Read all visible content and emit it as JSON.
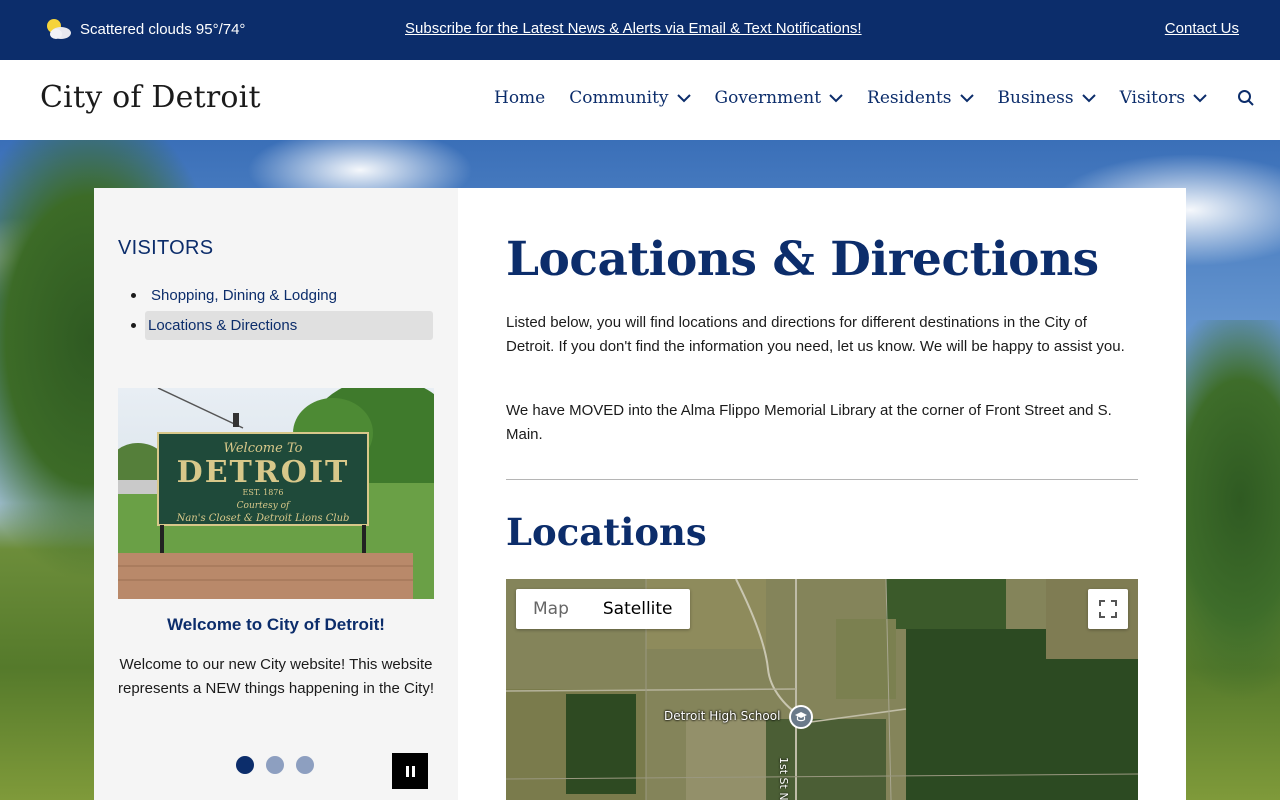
{
  "topbar": {
    "weather": "Scattered clouds 95°/74°",
    "subscribe_link": "Subscribe for the Latest News & Alerts via Email & Text Notifications!",
    "contact_link": "Contact Us"
  },
  "header": {
    "site_title": "City of Detroit",
    "nav": [
      {
        "label": "Home"
      },
      {
        "label": "Community"
      },
      {
        "label": "Government"
      },
      {
        "label": "Residents"
      },
      {
        "label": "Business"
      },
      {
        "label": "Visitors"
      }
    ]
  },
  "sidebar": {
    "heading": "VISITORS",
    "items": [
      {
        "label": "Shopping, Dining & Lodging"
      },
      {
        "label": "Locations & Directions"
      }
    ],
    "slide": {
      "sign_line1": "Welcome To",
      "sign_line2": "DETROIT",
      "sign_line3": "EST. 1876",
      "sign_line4": "Courtesy of",
      "sign_line5": "Nan's Closet & Detroit Lions Club",
      "title": "Welcome to City of Detroit!",
      "text": "Welcome to our new City website! This website represents a NEW things happening in the City!"
    }
  },
  "main": {
    "title": "Locations & Directions",
    "paragraph1": "Listed below, you will find locations and directions for different destinations in the City of Detroit. If you don't find the information you need, let us know. We will be happy to assist you.",
    "paragraph2": "We have MOVED into the Alma Flippo Memorial Library at the corner of Front Street and S. Main.",
    "section_title": "Locations",
    "map": {
      "map_label": "Map",
      "satellite_label": "Satellite",
      "place_label": "Detroit High School",
      "street_label": "1st St NW"
    }
  },
  "colors": {
    "brand_navy": "#0c2d6b",
    "sidebar_bg": "#f5f5f5",
    "active_item_bg": "#e0e0e0",
    "dot_inactive": "#8d9fc0"
  }
}
